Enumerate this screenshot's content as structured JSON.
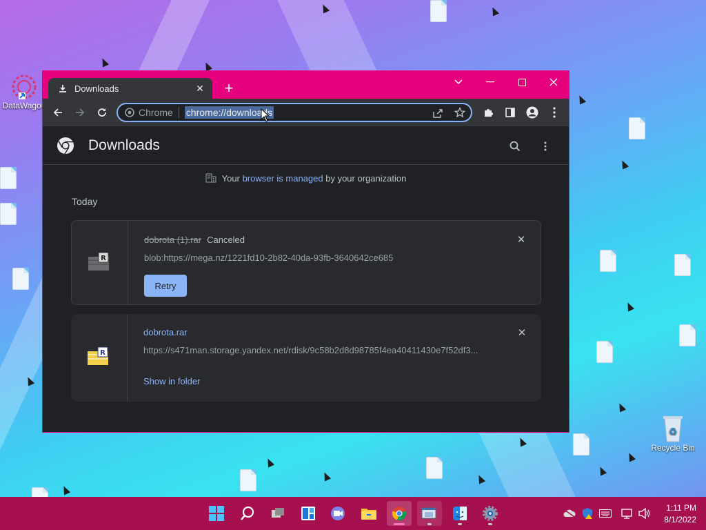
{
  "desktop": {
    "icons": [
      {
        "label": "DataWagon"
      },
      {
        "label": "Recycle Bin"
      }
    ]
  },
  "browser": {
    "tab": {
      "title": "Downloads"
    },
    "omnibox": {
      "site_label": "Chrome",
      "url": "chrome://downloads"
    },
    "page": {
      "title": "Downloads",
      "managed_notice": {
        "prefix": "Your ",
        "link": "browser is managed",
        "suffix": " by your organization"
      },
      "section_label": "Today",
      "downloads": [
        {
          "filename": "dobrota (1).rar",
          "status": "Canceled",
          "url": "blob:https://mega.nz/1221fd10-2b82-40da-93fb-3640642ce685",
          "action": "Retry"
        },
        {
          "filename": "dobrota.rar",
          "status": "",
          "url": "https://s471man.storage.yandex.net/rdisk/9c58b2d8d98785f4ea40411430e7f52df3...",
          "action": "Show in folder"
        }
      ]
    }
  },
  "taskbar": {
    "clock": {
      "time": "1:11 PM",
      "date": "8/1/2022"
    },
    "apps": [
      "start",
      "search",
      "task-view",
      "widgets",
      "chat",
      "file-explorer",
      "chrome",
      "app-window",
      "finder",
      "settings"
    ]
  },
  "colors": {
    "accent": "#e6007e",
    "taskbar": "#a6104f",
    "link": "#8ab4f8",
    "window_bg": "#202124"
  }
}
